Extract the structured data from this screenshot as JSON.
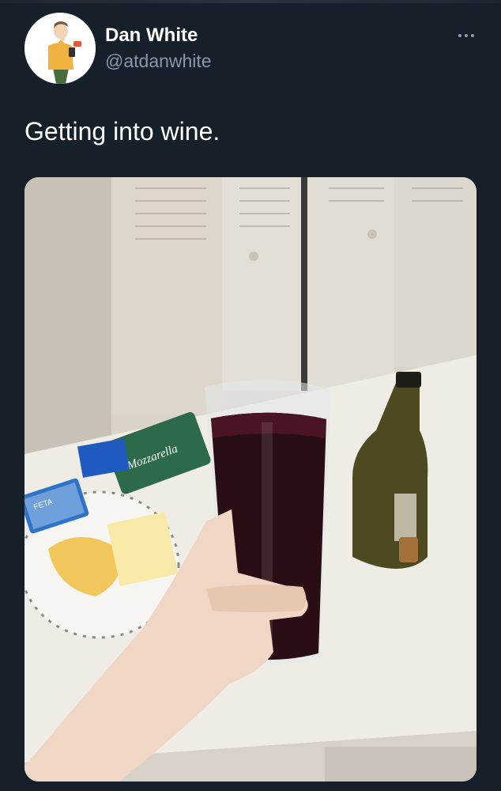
{
  "tweet": {
    "author": {
      "display_name": "Dan White",
      "handle": "@atdanwhite",
      "avatar_icon": "cartoon-avatar-icon"
    },
    "more_icon": "more-options-icon",
    "text": "Getting into wine.",
    "media": {
      "type": "photo",
      "package_text_1": "FETA",
      "package_text_2": "Mozzarella"
    }
  },
  "colors": {
    "background": "#15202b",
    "text_primary": "#ffffff",
    "text_secondary": "#8899a6"
  }
}
